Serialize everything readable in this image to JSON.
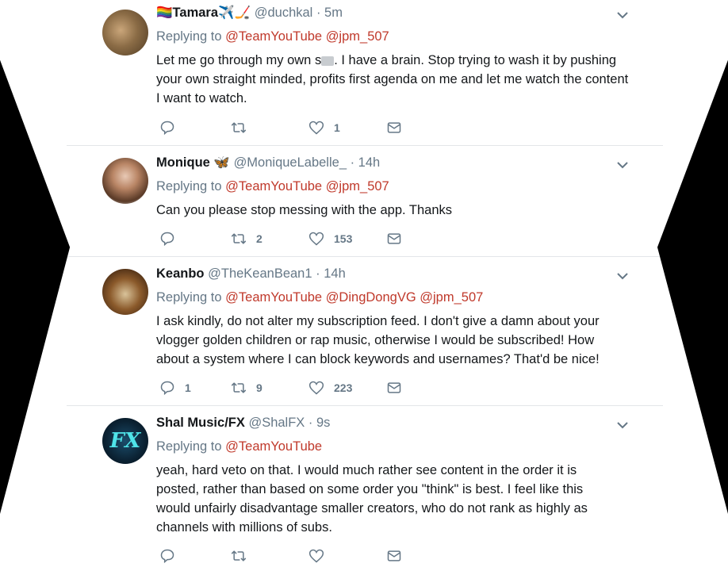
{
  "tweets": [
    {
      "name": "Tamara",
      "name_suffix_emoji": "✈️🏒",
      "name_prefix_emoji": "🏳️‍🌈",
      "handle": "@duchkal",
      "time": "· 5m",
      "replying_label": "Replying to",
      "mentions": [
        "@TeamYouTube",
        "@jpm_507"
      ],
      "body_pre": "Let me go through my own s",
      "body_post": ". I have a brain. Stop trying to wash it by pushing your own straight minded, profits first agenda on me and let me watch the content I want to watch.",
      "reply_count": "",
      "retweet_count": "",
      "like_count": "1"
    },
    {
      "name": "Monique",
      "name_suffix_emoji": "🦋",
      "handle": "@MoniqueLabelle_",
      "time": "· 14h",
      "replying_label": "Replying to",
      "mentions": [
        "@TeamYouTube",
        "@jpm_507"
      ],
      "body": "Can you please stop messing with the app. Thanks",
      "reply_count": "",
      "retweet_count": "2",
      "like_count": "153"
    },
    {
      "name": "Keanbo",
      "handle": "@TheKeanBean1",
      "time": "· 14h",
      "replying_label": "Replying to",
      "mentions": [
        "@TeamYouTube",
        "@DingDongVG",
        "@jpm_507"
      ],
      "body": "I ask kindly, do not alter my subscription feed. I don't give a damn about your vlogger golden children or rap music, otherwise I would be subscribed! How about a system where I can block keywords and usernames? That'd be nice!",
      "reply_count": "1",
      "retweet_count": "9",
      "like_count": "223"
    },
    {
      "name": "Shal Music/FX",
      "handle": "@ShalFX",
      "time": "· 9s",
      "replying_label": "Replying to",
      "mentions": [
        "@TeamYouTube"
      ],
      "body": "yeah, hard veto on that. I would much rather see content in the order it is posted, rather than based on some order you \"think\" is best. I feel like this would unfairly disadvantage smaller creators, who do not rank as highly as channels with millions of subs.",
      "reply_count": "",
      "retweet_count": "",
      "like_count": "",
      "avatar_text": "FX"
    }
  ],
  "icons": {
    "reply": "reply-icon",
    "retweet": "retweet-icon",
    "like": "heart-icon",
    "dm": "mail-icon",
    "more": "chevron-down-icon"
  },
  "colors": {
    "mention": "#c0392b",
    "meta": "#657786",
    "text": "#14171a",
    "divider": "#e3e6e9"
  }
}
